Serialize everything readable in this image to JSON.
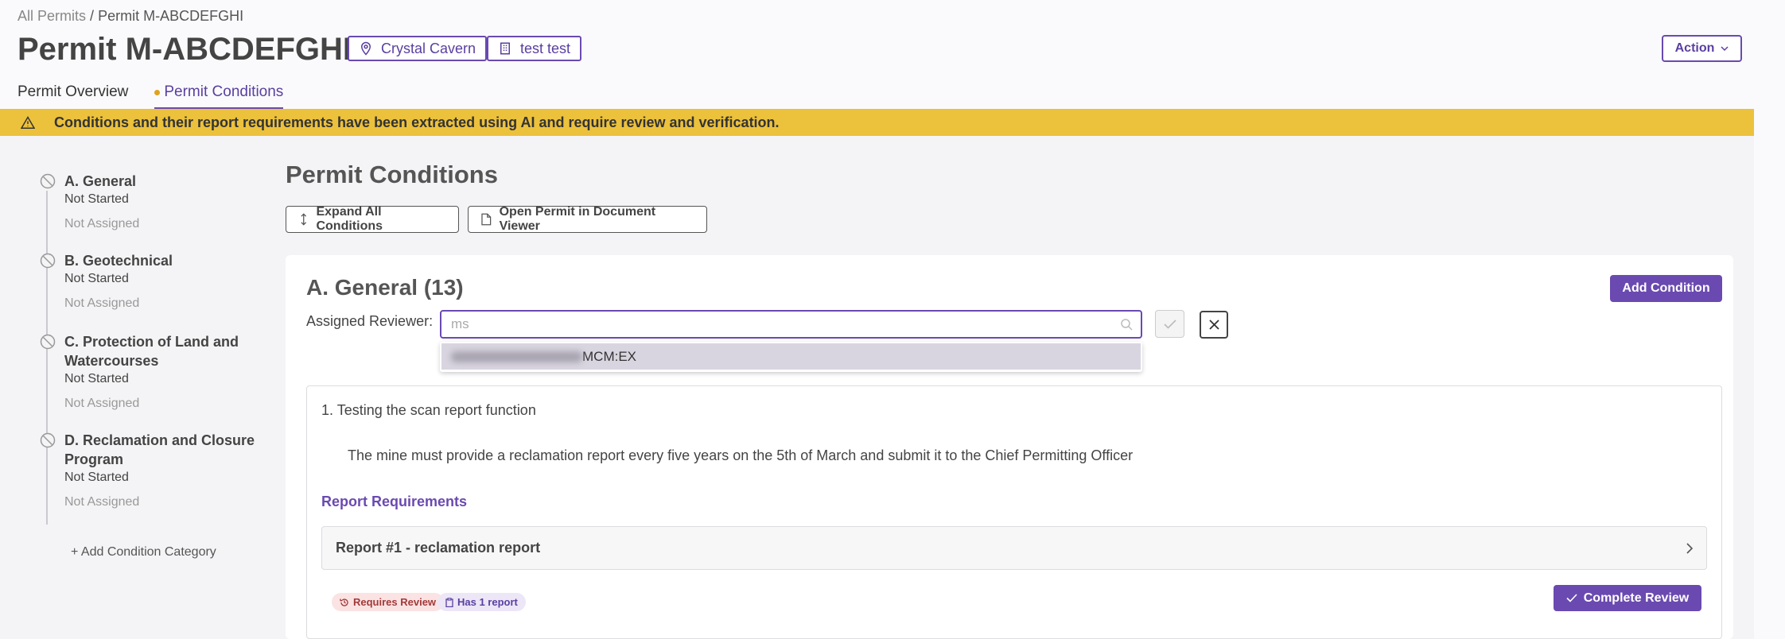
{
  "breadcrumb": {
    "root": "All Permits",
    "separator": "/",
    "current": "Permit M-ABCDEFGHI"
  },
  "header": {
    "title": "Permit M-ABCDEFGHI",
    "location_tag": "Crystal Cavern",
    "entity_tag": "test test",
    "action_label": "Action"
  },
  "tabs": [
    {
      "label": "Permit Overview",
      "active": false
    },
    {
      "label": "Permit Conditions",
      "active": true
    }
  ],
  "banner": {
    "text": "Conditions and their report requirements have been extracted using AI and require review and verification."
  },
  "sidebar": {
    "items": [
      {
        "name": "A. General",
        "status": "Not Started",
        "assignee": "Not Assigned"
      },
      {
        "name": "B. Geotechnical",
        "status": "Not Started",
        "assignee": "Not Assigned"
      },
      {
        "name": "C. Protection of Land and Watercourses",
        "status": "Not Started",
        "assignee": "Not Assigned"
      },
      {
        "name": "D. Reclamation and Closure Program",
        "status": "Not Started",
        "assignee": "Not Assigned"
      }
    ],
    "add_category": "+ Add Condition Category"
  },
  "main": {
    "title": "Permit Conditions",
    "expand_label": "Expand All Conditions",
    "open_viewer_label": "Open Permit in Document Viewer",
    "section": {
      "title": "A. General (13)",
      "add_condition_label": "Add Condition",
      "reviewer_label": "Assigned Reviewer:",
      "reviewer_value": "ms",
      "dropdown_option_suffix": "MCM:EX",
      "condition": {
        "title": "1.  Testing the scan report function",
        "text": "The mine must provide a reclamation report every five years on the 5th of March and submit it to the Chief Permitting Officer",
        "report_requirements_label": "Report Requirements",
        "report_row": "Report #1 - reclamation report",
        "badge_review": "Requires Review",
        "badge_report": "Has 1 report",
        "complete_label": "Complete Review"
      }
    }
  },
  "colors": {
    "accent": "#6a4ab0",
    "banner": "#ecc13c"
  }
}
